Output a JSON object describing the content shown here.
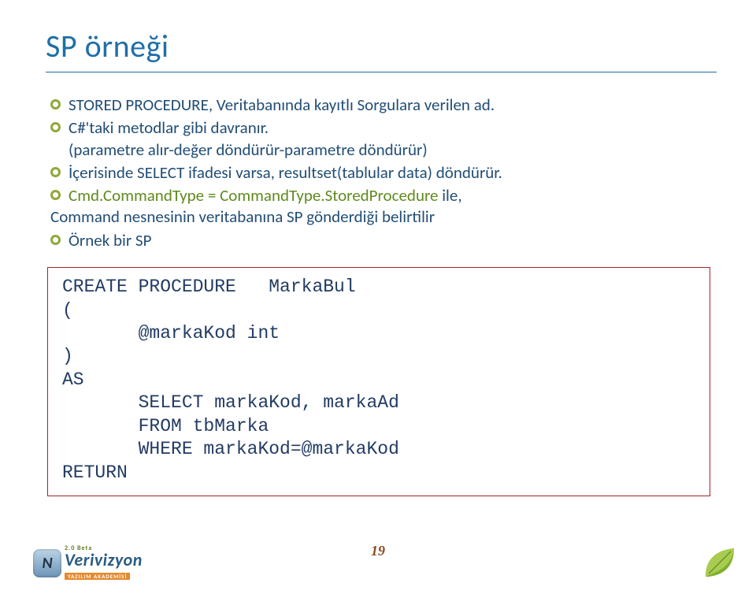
{
  "title": "SP örneği",
  "bullets": {
    "b1": "STORED PROCEDURE, Veritabanında kayıtlı Sorgulara verilen ad.",
    "b2": "C#'taki metodlar gibi davranır.",
    "b2c": "(parametre alır-değer döndürür-parametre döndürür)",
    "b3": "İçerisinde SELECT ifadesi varsa, resultset(tablular data) döndürür.",
    "b4a": "Cmd.CommandType = CommandType.StoredProcedure",
    "b4b": " ile,",
    "b4cont": "Command nesnesinin veritabanına SP gönderdiği belirtilir",
    "b5": "Örnek bir SP"
  },
  "code": "CREATE PROCEDURE   MarkaBul\n(\n       @markaKod int\n)\nAS\n       SELECT markaKod, markaAd\n       FROM tbMarka\n       WHERE markaKod=@markaKod\nRETURN",
  "page_number": "19",
  "logo": {
    "beta": "2.0 Beta",
    "brand": "Verivizyon",
    "sub": "YAZILIM AKADEMİSİ",
    "badge": "N"
  }
}
